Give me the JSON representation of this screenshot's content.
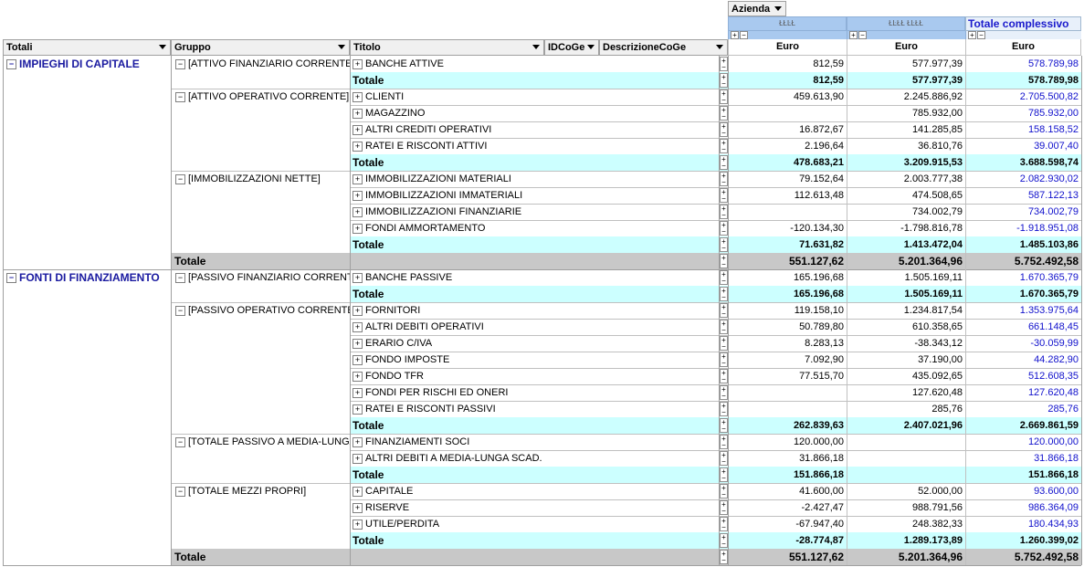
{
  "filter": {
    "azienda_label": "Azienda"
  },
  "columns": {
    "company1": "ŁŁĿŁ",
    "company2": "ŁĿŁŁ ŁĿŁŁ",
    "grand_total": "Totale complessivo",
    "currency": "Euro"
  },
  "row_headers": {
    "totali": "Totali",
    "gruppo": "Gruppo",
    "titolo": "Titolo",
    "idcoge": "IDCoGe",
    "descrizione": "DescrizioneCoGe"
  },
  "sections": [
    {
      "label": "IMPIEGHI DI CAPITALE",
      "groups": [
        {
          "label": "[ATTIVO FINANZIARIO CORRENTE]",
          "rows": [
            {
              "title": "BANCHE ATTIVE",
              "c1": "812,59",
              "c2": "577.977,39",
              "tot": "578.789,98"
            }
          ],
          "total": {
            "c1": "812,59",
            "c2": "577.977,39",
            "tot": "578.789,98"
          }
        },
        {
          "label": "[ATTIVO OPERATIVO CORRENTE]",
          "rows": [
            {
              "title": "CLIENTI",
              "c1": "459.613,90",
              "c2": "2.245.886,92",
              "tot": "2.705.500,82"
            },
            {
              "title": "MAGAZZINO",
              "c1": "",
              "c2": "785.932,00",
              "tot": "785.932,00"
            },
            {
              "title": "ALTRI CREDITI OPERATIVI",
              "c1": "16.872,67",
              "c2": "141.285,85",
              "tot": "158.158,52"
            },
            {
              "title": "RATEI E RISCONTI ATTIVI",
              "c1": "2.196,64",
              "c2": "36.810,76",
              "tot": "39.007,40"
            }
          ],
          "total": {
            "c1": "478.683,21",
            "c2": "3.209.915,53",
            "tot": "3.688.598,74"
          }
        },
        {
          "label": "[IMMOBILIZZAZIONI NETTE]",
          "rows": [
            {
              "title": "IMMOBILIZZAZIONI MATERIALI",
              "c1": "79.152,64",
              "c2": "2.003.777,38",
              "tot": "2.082.930,02"
            },
            {
              "title": "IMMOBILIZZAZIONI IMMATERIALI",
              "c1": "112.613,48",
              "c2": "474.508,65",
              "tot": "587.122,13"
            },
            {
              "title": "IMMOBILIZZAZIONI FINANZIARIE",
              "c1": "",
              "c2": "734.002,79",
              "tot": "734.002,79"
            },
            {
              "title": "FONDI AMMORTAMENTO",
              "c1": "-120.134,30",
              "c2": "-1.798.816,78",
              "tot": "-1.918.951,08"
            }
          ],
          "total": {
            "c1": "71.631,82",
            "c2": "1.413.472,04",
            "tot": "1.485.103,86"
          }
        }
      ],
      "total": {
        "c1": "551.127,62",
        "c2": "5.201.364,96",
        "tot": "5.752.492,58"
      }
    },
    {
      "label": "FONTI DI FINANZIAMENTO",
      "groups": [
        {
          "label": "[PASSIVO FINANZIARIO CORRENTE]",
          "rows": [
            {
              "title": "BANCHE PASSIVE",
              "c1": "165.196,68",
              "c2": "1.505.169,11",
              "tot": "1.670.365,79"
            }
          ],
          "total": {
            "c1": "165.196,68",
            "c2": "1.505.169,11",
            "tot": "1.670.365,79"
          }
        },
        {
          "label": "[PASSIVO OPERATIVO CORRENTE]",
          "rows": [
            {
              "title": "FORNITORI",
              "c1": "119.158,10",
              "c2": "1.234.817,54",
              "tot": "1.353.975,64"
            },
            {
              "title": "ALTRI DEBITI OPERATIVI",
              "c1": "50.789,80",
              "c2": "610.358,65",
              "tot": "661.148,45"
            },
            {
              "title": "ERARIO C/IVA",
              "c1": "8.283,13",
              "c2": "-38.343,12",
              "tot": "-30.059,99"
            },
            {
              "title": "FONDO IMPOSTE",
              "c1": "7.092,90",
              "c2": "37.190,00",
              "tot": "44.282,90"
            },
            {
              "title": "FONDO TFR",
              "c1": "77.515,70",
              "c2": "435.092,65",
              "tot": "512.608,35"
            },
            {
              "title": "FONDI PER RISCHI ED ONERI",
              "c1": "",
              "c2": "127.620,48",
              "tot": "127.620,48"
            },
            {
              "title": "RATEI E RISCONTI PASSIVI",
              "c1": "",
              "c2": "285,76",
              "tot": "285,76"
            }
          ],
          "total": {
            "c1": "262.839,63",
            "c2": "2.407.021,96",
            "tot": "2.669.861,59"
          }
        },
        {
          "label": "[TOTALE PASSIVO A MEDIA-LUNGA",
          "rows": [
            {
              "title": "FINANZIAMENTI SOCI",
              "c1": "120.000,00",
              "c2": "",
              "tot": "120.000,00"
            },
            {
              "title": "ALTRI DEBITI A MEDIA-LUNGA SCAD.",
              "c1": "31.866,18",
              "c2": "",
              "tot": "31.866,18"
            }
          ],
          "total": {
            "c1": "151.866,18",
            "c2": "",
            "tot": "151.866,18"
          }
        },
        {
          "label": "[TOTALE MEZZI PROPRI]",
          "rows": [
            {
              "title": "CAPITALE",
              "c1": "41.600,00",
              "c2": "52.000,00",
              "tot": "93.600,00"
            },
            {
              "title": "RISERVE",
              "c1": "-2.427,47",
              "c2": "988.791,56",
              "tot": "986.364,09"
            },
            {
              "title": "UTILE/PERDITA",
              "c1": "-67.947,40",
              "c2": "248.382,33",
              "tot": "180.434,93"
            }
          ],
          "total": {
            "c1": "-28.774,87",
            "c2": "1.289.173,89",
            "tot": "1.260.399,02"
          }
        }
      ],
      "total": {
        "c1": "551.127,62",
        "c2": "5.201.364,96",
        "tot": "5.752.492,58"
      }
    }
  ],
  "labels": {
    "totale": "Totale"
  },
  "colors": {
    "subtotal_bg": "#ccffff",
    "grandtotal_bg": "#c8c8c8",
    "section_text": "#1a1aa0",
    "total_col_text": "#1111cc"
  }
}
